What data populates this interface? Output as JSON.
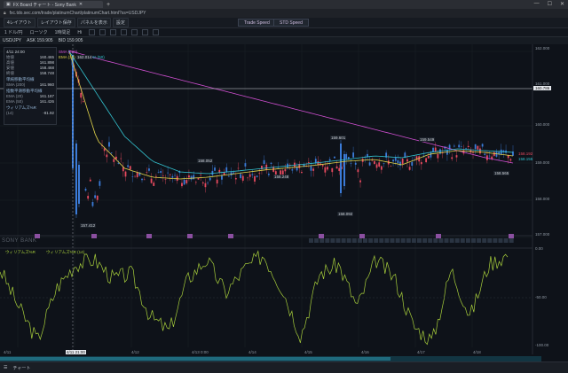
{
  "browser": {
    "tab_title": "FX Board チャート - Sony Bank",
    "url": "fxc.tdo.sec.com/trade/platinumChart/platinumChart.html?ss=USDJPY"
  },
  "appbar": {
    "items": [
      "4レイアウト",
      "レイアウト保存",
      "パネルを表示",
      "設定"
    ],
    "speed_labels": [
      "Trade Speed",
      "STD Speed"
    ]
  },
  "toolbar": {
    "symbol": "1 ドル/円",
    "timeframe": "1時間足",
    "chart_type": "ローソク",
    "display": "Hi"
  },
  "chart_header": {
    "pair": "USD/JPY",
    "values": [
      "ASK 159.905",
      "BID 159.905"
    ]
  },
  "info_panel": {
    "date": "4/11 24:00",
    "ohlc": [
      {
        "label": "始値",
        "value": "160.465"
      },
      {
        "label": "高値",
        "value": "161.898"
      },
      {
        "label": "安値",
        "value": "158.468"
      },
      {
        "label": "終値",
        "value": "158.748"
      }
    ],
    "sma_header": "単純移動平均線",
    "sma": [
      {
        "label": "SMA (200)",
        "value": "161.960"
      }
    ],
    "ema_header": "指数平滑移動平均線",
    "ema": [
      {
        "label": "EMA (20)",
        "value": "161.187"
      },
      {
        "label": "EMA (50)",
        "value": "161.426"
      }
    ],
    "wr_header": "ウィリアムズ%R",
    "wr": [
      {
        "label": "(14)",
        "value": "-81.92"
      }
    ]
  },
  "legend_main": [
    "SMA (200)",
    "EMA (20)",
    "EMA (50)"
  ],
  "legend_sub": [
    "ウィリアムズ%R",
    "ウィリアムズ%R (14)"
  ],
  "price_axis": [
    "162.000",
    "161.000",
    "160.000",
    "159.000",
    "158.000",
    "157.000"
  ],
  "price_axis_current": "160.786",
  "price_axis_right_labels": [
    "158.192",
    "158.155"
  ],
  "wr_axis": [
    "0.00",
    "-50.00",
    "-100.00"
  ],
  "time_axis": [
    "4/11",
    "4/11 21:00",
    "4/12",
    "4/13 0:00",
    "4/14",
    "4/15",
    "4/16",
    "4/17",
    "4/18"
  ],
  "annotations": [
    {
      "label": "4/11 13:00",
      "value": "162.014"
    },
    {
      "label": "4/11",
      "value": "157.412"
    },
    {
      "label": "4/14",
      "value": "158.052"
    },
    {
      "label": "4/15",
      "value": "158.248"
    },
    {
      "label": "4/16",
      "value": "159.601"
    },
    {
      "label": "4/16",
      "value": "158.092"
    },
    {
      "label": "4/17",
      "value": "159.549"
    },
    {
      "label": "4/18",
      "value": "158.565"
    }
  ],
  "watermark": "SONY BANK",
  "bottom": {
    "chart_tab": "チャート"
  },
  "colors": {
    "up": "#e84a5f",
    "down": "#3b7bd8",
    "sma200": "#d04fd1",
    "ema20": "#e3d54b",
    "ema50": "#33c3d0",
    "wr": "#a8cf3b"
  },
  "chart_data": {
    "type": "line",
    "ylim": [
      156.8,
      162.2
    ],
    "series": [
      {
        "name": "SMA (200)",
        "values": [
          162.02,
          161.8,
          161.6,
          161.4,
          161.2,
          161.0,
          160.8,
          160.6,
          160.4,
          160.2,
          160.0,
          159.8,
          159.6,
          159.4,
          159.2,
          159.0,
          158.85
        ]
      },
      {
        "name": "EMA (20)",
        "values": [
          162.0,
          159.5,
          158.7,
          158.45,
          158.4,
          158.45,
          158.55,
          158.65,
          158.72,
          158.8,
          158.9,
          158.95,
          158.8,
          159.1,
          159.2,
          159.15,
          159.05
        ]
      },
      {
        "name": "EMA (50)",
        "values": [
          162.0,
          160.8,
          159.6,
          158.9,
          158.6,
          158.55,
          158.62,
          158.7,
          158.78,
          158.86,
          158.95,
          159.05,
          159.0,
          159.15,
          159.25,
          159.2,
          159.15
        ]
      }
    ],
    "wr_values": [
      -20,
      -60,
      -95,
      -40,
      -15,
      -10,
      -30,
      -25,
      -70,
      -85,
      -30,
      -10,
      -45,
      -20,
      -5,
      -40,
      -90,
      -25,
      -15,
      -60,
      -10,
      -30,
      -80,
      -95,
      -20,
      -70,
      -15,
      -5
    ]
  }
}
